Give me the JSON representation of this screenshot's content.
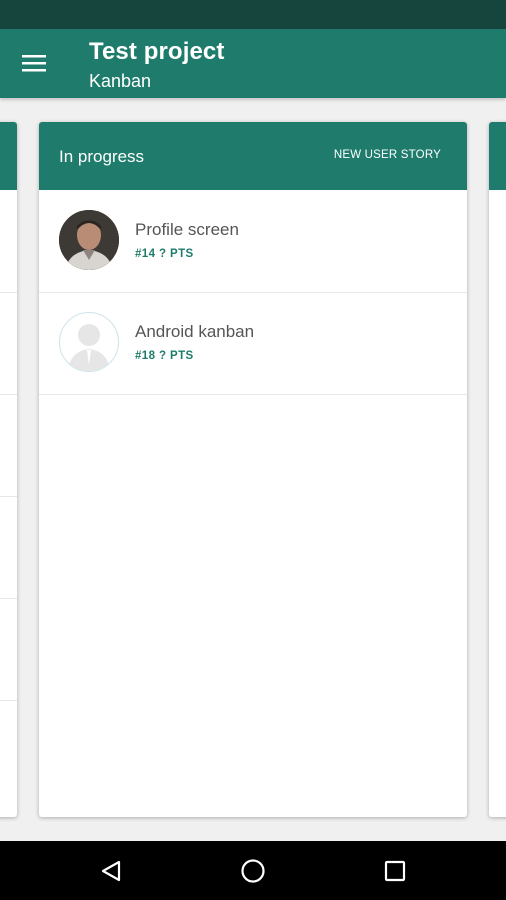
{
  "app_bar": {
    "title": "Test project",
    "subtitle": "Kanban",
    "menu_icon": "hamburger-menu-icon"
  },
  "column": {
    "title": "In progress",
    "action_label": "NEW USER STORY",
    "stories": [
      {
        "title": "Profile screen",
        "meta": "#14  ?  PTS",
        "avatar": "user-photo"
      },
      {
        "title": "Android kanban",
        "meta": "#18  ?  PTS",
        "avatar": "default-user-icon"
      }
    ]
  },
  "nav": {
    "back_icon": "back-triangle-icon",
    "home_icon": "home-circle-icon",
    "recents_icon": "recents-square-icon"
  },
  "colors": {
    "primary": "#1f7c6c",
    "status_bar": "#15453d",
    "background": "#f0f0f0"
  }
}
